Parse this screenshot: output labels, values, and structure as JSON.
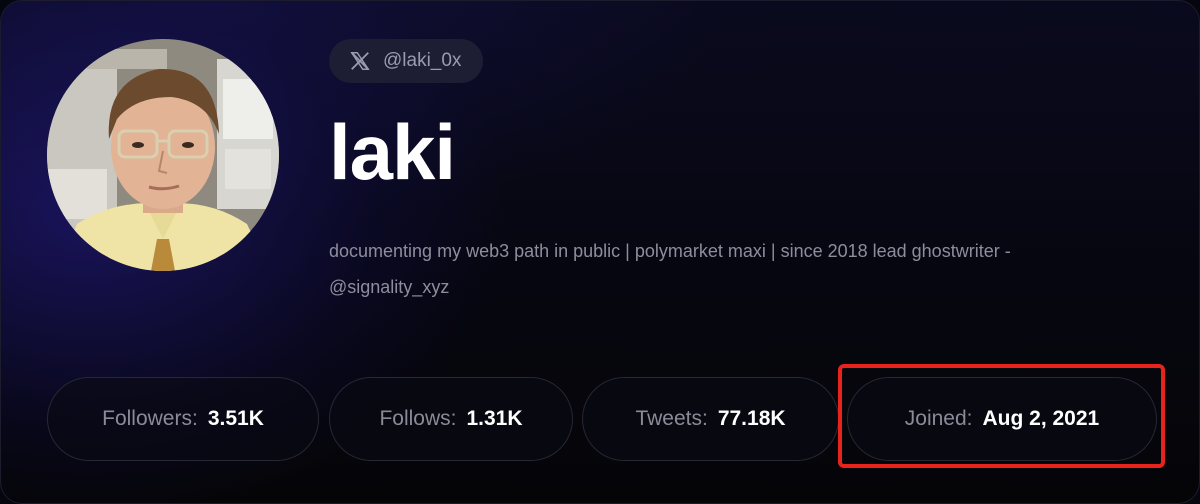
{
  "profile": {
    "handle": "@laki_0x",
    "handle_icon": "x-logo-icon",
    "name": "laki",
    "bio": "documenting my web3 path in public | polymarket maxi | since 2018 lead ghostwriter - @signality_xyz"
  },
  "stats": {
    "followers": {
      "label": "Followers:",
      "value": "3.51K"
    },
    "follows": {
      "label": "Follows:",
      "value": "1.31K"
    },
    "tweets": {
      "label": "Tweets:",
      "value": "77.18K"
    },
    "joined": {
      "label": "Joined:",
      "value": "Aug 2, 2021"
    }
  },
  "colors": {
    "highlight": "#e8231c",
    "background": "#06060f",
    "accent_glow": "#281e96"
  }
}
